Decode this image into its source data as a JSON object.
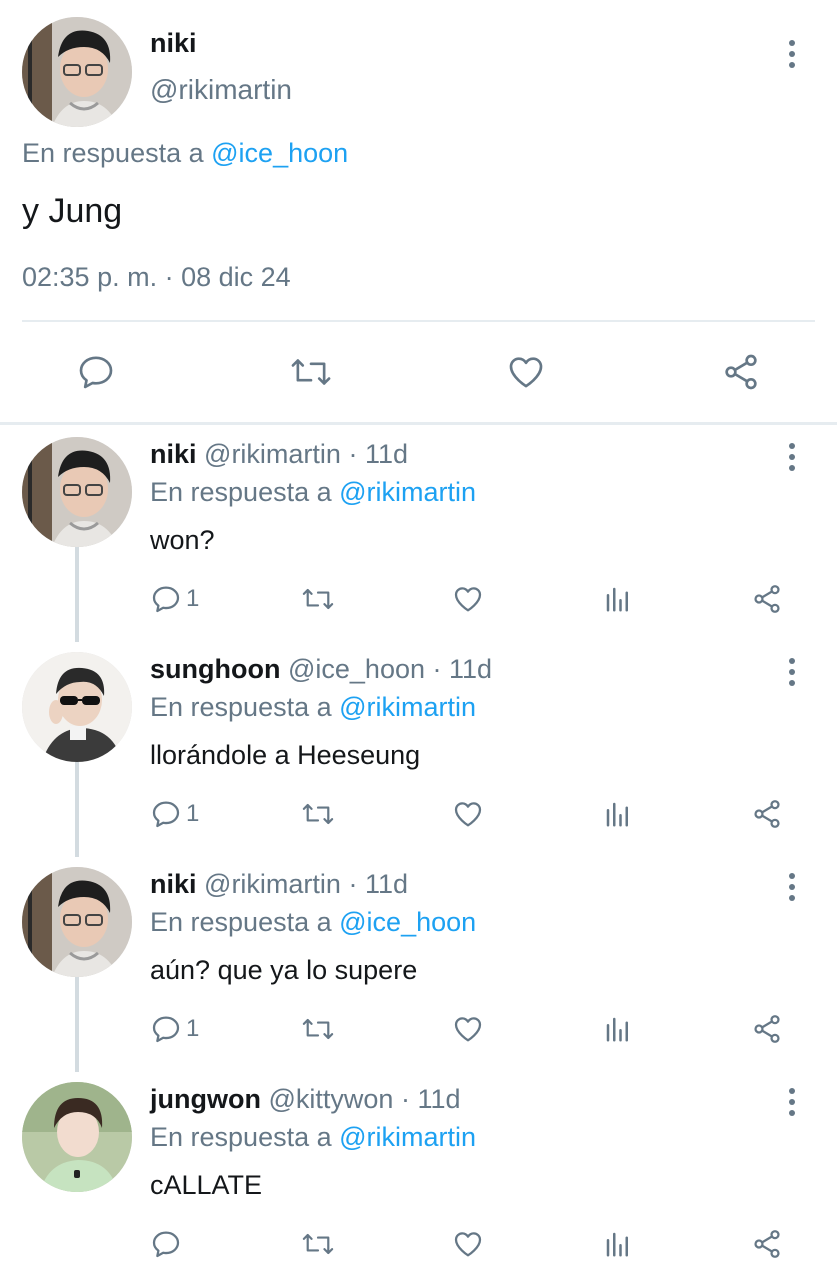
{
  "main_tweet": {
    "name": "niki",
    "handle": "@rikimartin",
    "reply_prefix": "En respuesta a",
    "reply_to": "@ice_hoon",
    "text": "y Jung",
    "timestamp": "02:35 p. m. · 08 dic 24"
  },
  "replies": [
    {
      "name": "niki",
      "handle": "@rikimartin",
      "age": "· 11d",
      "reply_prefix": "En respuesta a",
      "reply_to": "@rikimartin",
      "text": "won?",
      "reply_count": "1"
    },
    {
      "name": "sunghoon",
      "handle": "@ice_hoon",
      "age": "· 11d",
      "reply_prefix": "En respuesta a",
      "reply_to": "@rikimartin",
      "text": "llorándole a Heeseung",
      "reply_count": "1"
    },
    {
      "name": "niki",
      "handle": "@rikimartin",
      "age": "· 11d",
      "reply_prefix": "En respuesta a",
      "reply_to": "@ice_hoon",
      "text": "aún? que ya lo supere",
      "reply_count": "1"
    },
    {
      "name": "jungwon",
      "handle": "@kittywon",
      "age": "· 11d",
      "reply_prefix": "En respuesta a",
      "reply_to": "@rikimartin",
      "text": "cALLATE",
      "reply_count": ""
    }
  ],
  "icons": {
    "reply": "speech-bubble-icon",
    "retweet": "retweet-icon",
    "like": "heart-icon",
    "analytics": "bar-chart-icon",
    "share": "share-icon",
    "more": "vertical-dots-icon"
  },
  "colors": {
    "text": "#14171a",
    "muted": "#657786",
    "link": "#1da1f2",
    "divider": "#e6ecf0"
  }
}
